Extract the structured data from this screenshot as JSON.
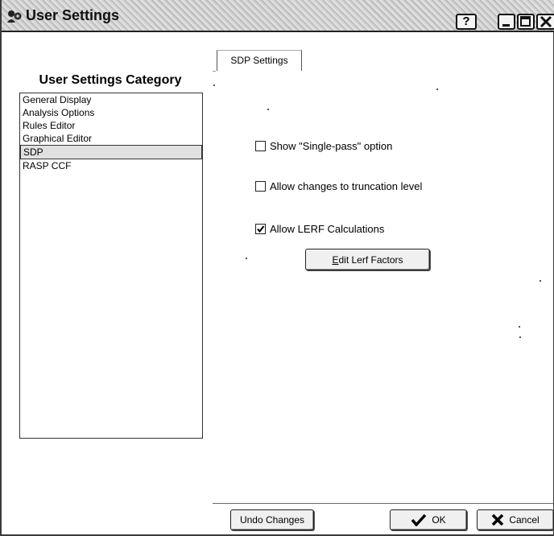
{
  "window": {
    "title": "User Settings"
  },
  "titlebar_buttons": {
    "help_label": "?"
  },
  "sidebar": {
    "heading": "User Settings Category",
    "items": [
      {
        "label": "General Display",
        "selected": false
      },
      {
        "label": "Analysis Options",
        "selected": false
      },
      {
        "label": "Rules Editor",
        "selected": false
      },
      {
        "label": "Graphical Editor",
        "selected": false
      },
      {
        "label": "SDP",
        "selected": true
      },
      {
        "label": "RASP CCF",
        "selected": false
      }
    ]
  },
  "tabs": [
    {
      "label": "SDP Settings",
      "active": true
    }
  ],
  "options": [
    {
      "label": "Show \"Single-pass\" option",
      "checked": false
    },
    {
      "label": "Allow changes to truncation level",
      "checked": false
    },
    {
      "label": "Allow LERF Calculations",
      "checked": true
    }
  ],
  "buttons": {
    "edit_lerf_mnemonic": "E",
    "edit_lerf_rest": "dit Lerf Factors",
    "undo": "Undo Changes",
    "ok": "OK",
    "cancel": "Cancel"
  },
  "icons": {
    "app": "user-settings-icon",
    "ok": "checkmark-icon",
    "cancel": "x-icon"
  }
}
